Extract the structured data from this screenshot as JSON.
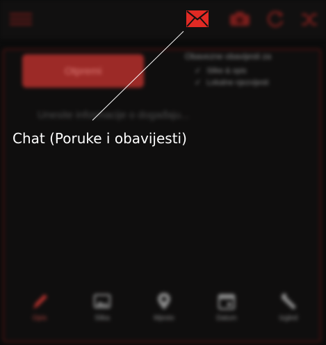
{
  "toolbar": {
    "icons": [
      "menu-icon",
      "mail-icon",
      "camera-icon",
      "refresh-icon",
      "shuffle-icon"
    ],
    "accent": "#e02a24"
  },
  "main": {
    "open_button_label": "Otpremi",
    "options_title": "Obavezne obavijesti za",
    "options": [
      {
        "label": "Slike & opis",
        "checked": true
      },
      {
        "label": "Lokalne njezvijesti",
        "checked": true
      }
    ],
    "info_placeholder": "Unesite informacije o događaju..."
  },
  "bottom_nav": {
    "items": [
      {
        "label": "Opis",
        "icon": "pencil-icon",
        "active": true
      },
      {
        "label": "Slika",
        "icon": "image-icon",
        "active": false
      },
      {
        "label": "Mjesto",
        "icon": "location-pin-icon",
        "active": false
      },
      {
        "label": "Datum",
        "icon": "calendar-icon",
        "active": false
      },
      {
        "label": "Izgled",
        "icon": "wrench-icon",
        "active": false
      }
    ]
  },
  "annotation": {
    "caption": "Chat (Poruke i obavijesti)"
  }
}
